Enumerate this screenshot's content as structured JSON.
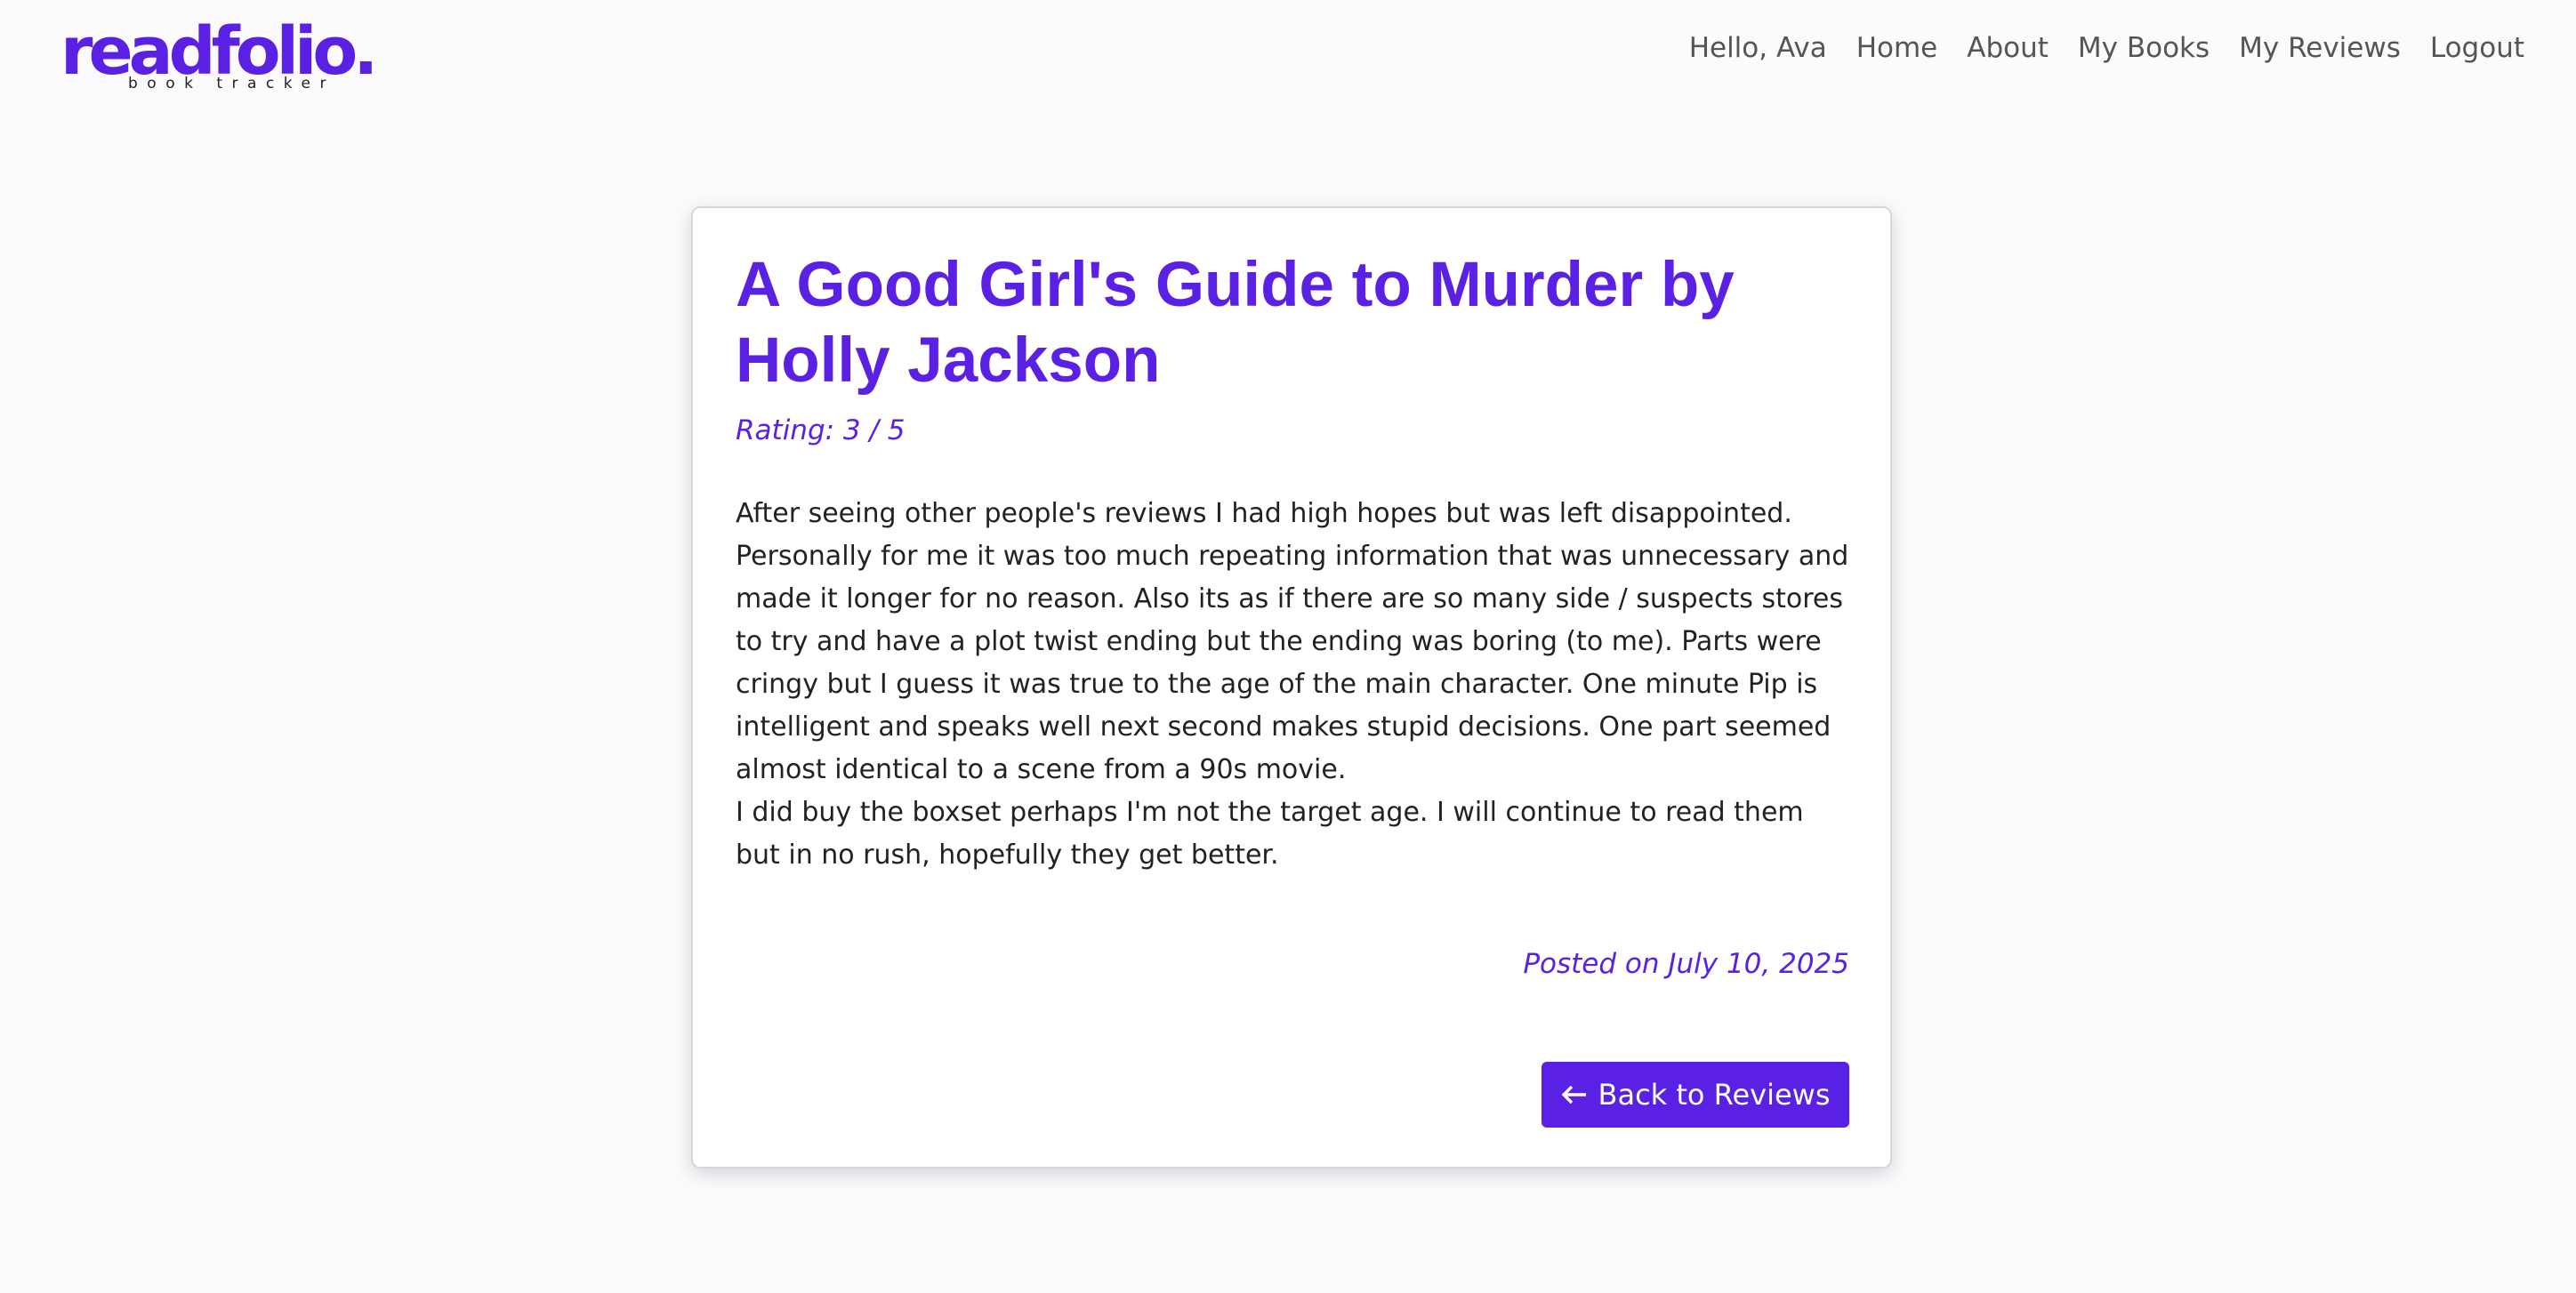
{
  "brand": {
    "name": "readfolio.",
    "tagline": "book tracker",
    "color": "#5a20e3"
  },
  "nav": {
    "greeting": "Hello, Ava",
    "items": [
      {
        "label": "Home"
      },
      {
        "label": "About"
      },
      {
        "label": "My Books"
      },
      {
        "label": "My Reviews"
      },
      {
        "label": "Logout"
      }
    ]
  },
  "review": {
    "title": "A Good Girl's Guide to Murder by Holly Jackson",
    "rating_text": "Rating: 3 / 5",
    "rating": 3,
    "rating_max": 5,
    "paragraphs": [
      "After seeing other people's reviews I had high hopes but was left disappointed. Personally for me it was too much repeating information that was unnecessary and made it longer for no reason. Also its as if there are so many side / suspects stores to try and have a plot twist ending but the ending was boring (to me). Parts were cringy but I guess it was true to the age of the main character. One minute Pip is intelligent and speaks well next second makes stupid decisions. One part seemed almost identical to a scene from a 90s movie.",
      "I did buy the boxset perhaps I'm not the target age. I will continue to read them but in no rush, hopefully they get better."
    ],
    "posted_text": "Posted on July 10, 2025",
    "back_button": {
      "icon": "arrow-left-icon",
      "label": "Back to Reviews"
    }
  }
}
